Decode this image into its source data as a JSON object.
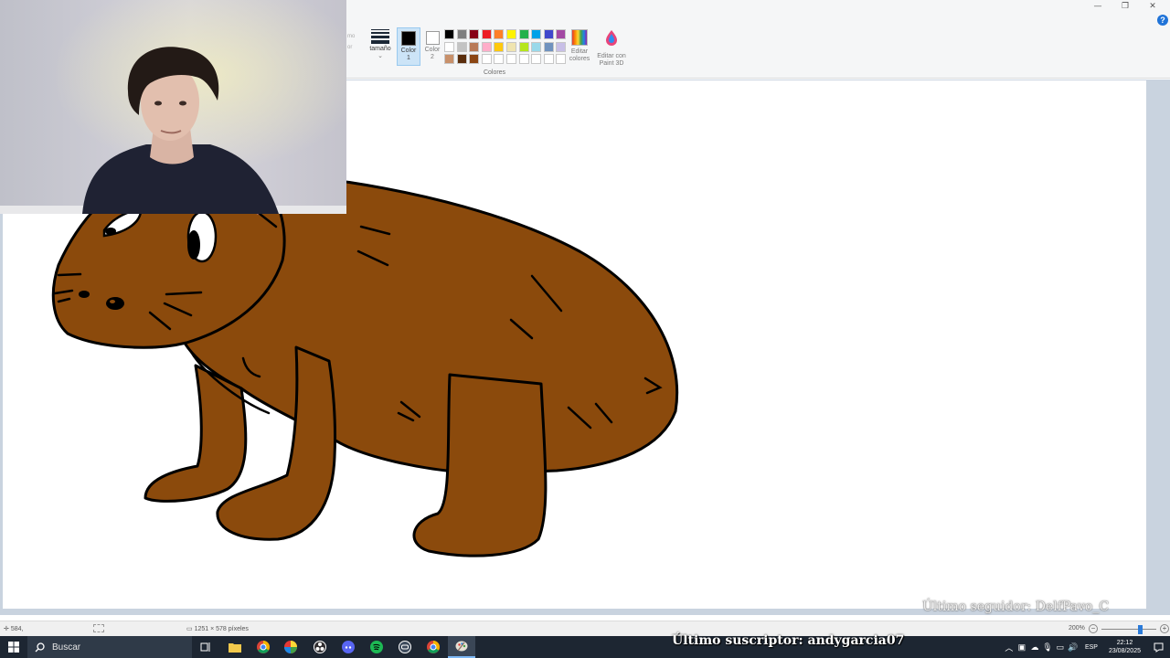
{
  "window": {
    "controls": {
      "minimize": "—",
      "maximize": "❐",
      "close": "✕"
    },
    "help": "?"
  },
  "ribbon": {
    "faded_labels": [
      "mo",
      "or"
    ],
    "size_label": "tamaño",
    "color1_label": "Color",
    "color1_number": "1",
    "color2_label": "Color",
    "color2_number": "2",
    "palette": [
      "#000000",
      "#7f7f7f",
      "#880015",
      "#ed1c24",
      "#ff7f27",
      "#fff200",
      "#22b14c",
      "#00a2e8",
      "#3f48cc",
      "#a349a4",
      "#ffffff",
      "#c3c3c3",
      "#b97a57",
      "#ffaec9",
      "#ffc90e",
      "#efe4b0",
      "#b5e61d",
      "#99d9ea",
      "#7092be",
      "#c8bfe7",
      "#c8906a",
      "#5a2d0c",
      "#8b4513",
      "#ffffff",
      "#ffffff",
      "#ffffff",
      "#ffffff",
      "#ffffff",
      "#ffffff",
      "#ffffff"
    ],
    "colors_group_label": "Colores",
    "edit_colors_label": "Editar colores",
    "paint3d_label": "Editar con Paint 3D"
  },
  "canvas": {
    "follower_text": "Último seguidor: DelfPavo_C",
    "fill_color": "#8b4a0c",
    "outline_color": "#000000",
    "ear_pink": "#ff9ec4"
  },
  "statusbar": {
    "position": "584,",
    "size": "1251 × 578 píxeles",
    "zoom": "200%",
    "zoom_fraction": 0.7
  },
  "taskbar": {
    "search_placeholder": "Buscar",
    "subscriber_text": "Último suscriptor: andygarcia07",
    "language": "ESP",
    "time": "22:12",
    "date": "23/08/2025"
  }
}
